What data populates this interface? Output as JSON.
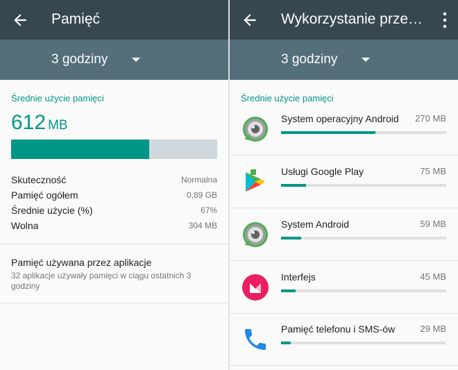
{
  "left": {
    "title": "Pamięć",
    "period": "3 godziny",
    "section_label": "Średnie użycie pamięci",
    "avg_value": "612",
    "avg_unit": "MB",
    "usage_fraction": 0.67,
    "stats": [
      {
        "key": "Skuteczność",
        "value": "Normalna"
      },
      {
        "key": "Pamięć ogółem",
        "value": "0,89 GB"
      },
      {
        "key": "Średnie użycie (%)",
        "value": "67%"
      },
      {
        "key": "Wolna",
        "value": "304 MB"
      }
    ],
    "apps_link": {
      "title": "Pamięć używana przez aplikacje",
      "subtitle": "32 aplikacje używały pamięci w ciągu ostatnich 3 godziny"
    }
  },
  "right": {
    "title": "Wykorzystanie przez aplikacje",
    "period": "3 godziny",
    "section_label": "Średnie użycie pamięci",
    "apps": [
      {
        "name": "System operacyjny Android",
        "size": "270 MB",
        "fraction": 0.57,
        "icon": "android-os-icon"
      },
      {
        "name": "Usługi Google Play",
        "size": "75 MB",
        "fraction": 0.15,
        "icon": "google-play-services-icon"
      },
      {
        "name": "System Android",
        "size": "59 MB",
        "fraction": 0.12,
        "icon": "android-system-icon"
      },
      {
        "name": "Interfejs",
        "size": "45 MB",
        "fraction": 0.09,
        "icon": "interface-launcher-icon"
      },
      {
        "name": "Pamięć telefonu i SMS-ów",
        "size": "29 MB",
        "fraction": 0.06,
        "icon": "phone-icon"
      }
    ]
  },
  "colors": {
    "appbar": "#37474f",
    "spinnerbar": "#546e7a",
    "accent": "#009688",
    "bar_track": "#cfd8dc"
  }
}
